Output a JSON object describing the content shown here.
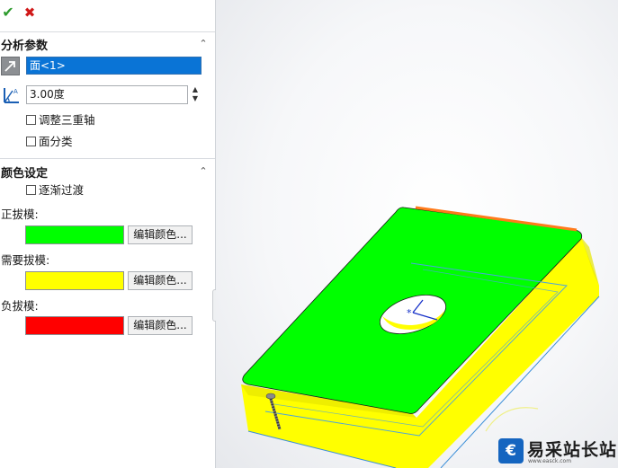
{
  "toolbar": {
    "ok_icon": "checkmark-icon",
    "cancel_icon": "close-icon"
  },
  "analysis": {
    "title": "分析参数",
    "collapse_glyph": "⌃",
    "direction_icon": "direction-arrow-icon",
    "face_value": "面<1>",
    "angle_icon": "draft-angle-icon",
    "angle_value": "3.00度",
    "adjust_triad_label": "调整三重轴",
    "face_classify_label": "面分类"
  },
  "color": {
    "title": "颜色设定",
    "collapse_glyph": "⌃",
    "gradient_label": "逐渐过渡",
    "positive_label": "正拔模:",
    "positive_color": "#00ff00",
    "needs_label": "需要拔模:",
    "needs_color": "#ffff00",
    "negative_label": "负拔模:",
    "negative_color": "#ff0000",
    "edit_button_label": "编辑颜色..."
  },
  "watermark": {
    "logo_glyph": "€",
    "text": "易采站长站",
    "sub": "www.easck.com"
  }
}
